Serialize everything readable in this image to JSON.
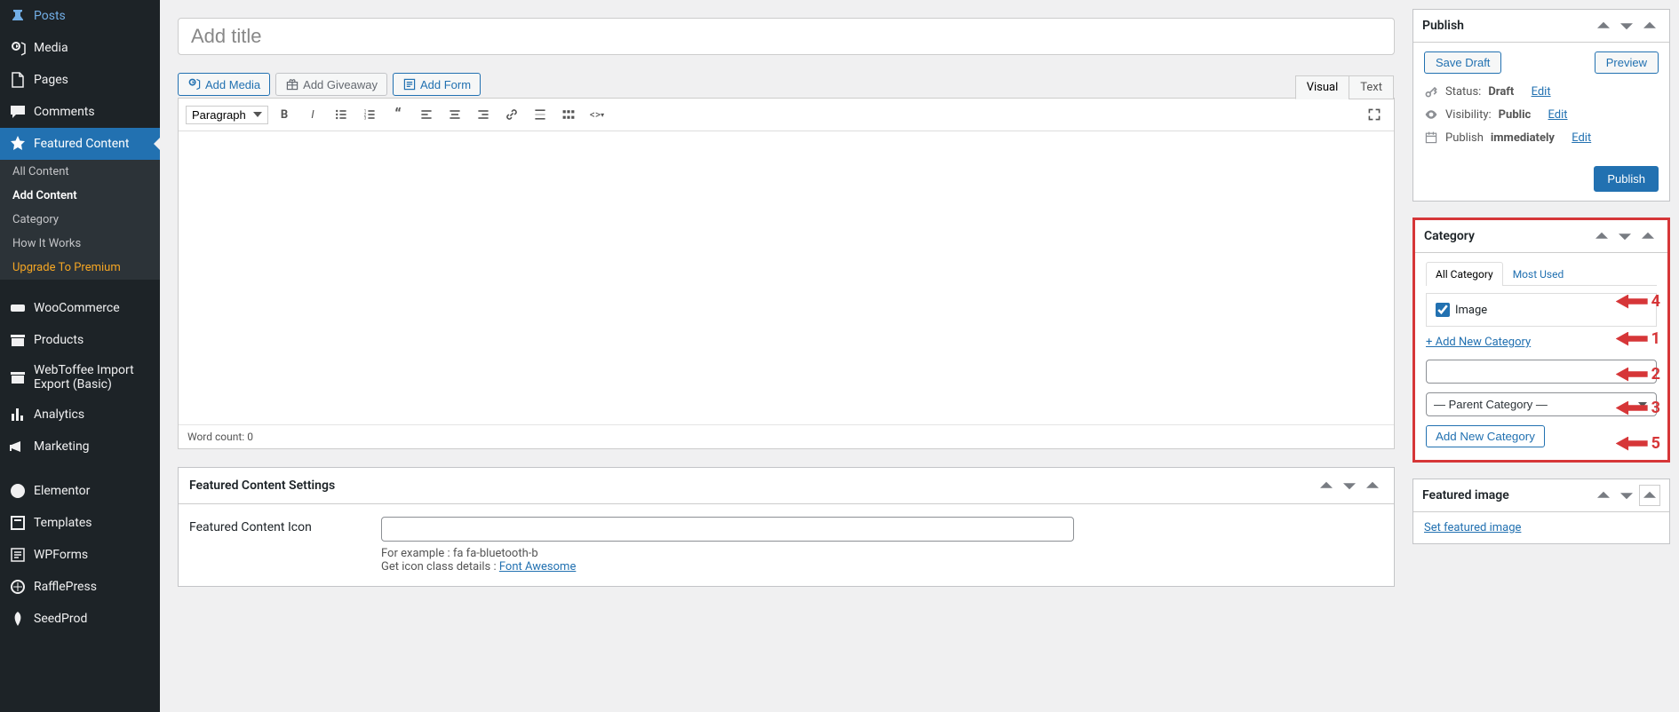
{
  "sidebar": {
    "items": [
      {
        "label": "Posts",
        "icon": "pin"
      },
      {
        "label": "Media",
        "icon": "media"
      },
      {
        "label": "Pages",
        "icon": "page"
      },
      {
        "label": "Comments",
        "icon": "comment"
      },
      {
        "label": "Featured Content",
        "icon": "star",
        "active": true
      },
      {
        "label": "WooCommerce",
        "icon": "woo"
      },
      {
        "label": "Products",
        "icon": "archive"
      },
      {
        "label": "WebToffee Import Export (Basic)",
        "icon": "archive"
      },
      {
        "label": "Analytics",
        "icon": "chart"
      },
      {
        "label": "Marketing",
        "icon": "megaphone"
      },
      {
        "label": "Elementor",
        "icon": "elementor"
      },
      {
        "label": "Templates",
        "icon": "templates"
      },
      {
        "label": "WPForms",
        "icon": "wpforms"
      },
      {
        "label": "RafflePress",
        "icon": "raffle"
      },
      {
        "label": "SeedProd",
        "icon": "seed"
      }
    ],
    "submenu": [
      {
        "label": "All Content"
      },
      {
        "label": "Add Content",
        "selected": true
      },
      {
        "label": "Category"
      },
      {
        "label": "How It Works"
      },
      {
        "label": "Upgrade To Premium",
        "premium": true
      }
    ]
  },
  "editor": {
    "title_placeholder": "Add title",
    "media_buttons": [
      {
        "label": "Add Media",
        "icon": "media"
      },
      {
        "label": "Add Giveaway",
        "icon": "gift"
      },
      {
        "label": "Add Form",
        "icon": "form"
      }
    ],
    "tabs": {
      "visual": "Visual",
      "text": "Text"
    },
    "format_dropdown": "Paragraph",
    "word_count_label": "Word count: ",
    "word_count": 0
  },
  "settings_box": {
    "title": "Featured Content Settings",
    "icon_label": "Featured Content Icon",
    "icon_help1": "For example : fa fa-bluetooth-b",
    "icon_help2": "Get icon class details : ",
    "icon_link": "Font Awesome"
  },
  "publish": {
    "title": "Publish",
    "save_draft": "Save Draft",
    "preview": "Preview",
    "status_label": "Status: ",
    "status_value": "Draft",
    "visibility_label": "Visibility: ",
    "visibility_value": "Public",
    "publish_label": "Publish ",
    "publish_value": "immediately",
    "edit": "Edit",
    "publish_btn": "Publish"
  },
  "category": {
    "title": "Category",
    "tab_all": "All Category",
    "tab_most": "Most Used",
    "item_label": "Image",
    "add_link": "+ Add New Category",
    "parent_placeholder": "— Parent Category —",
    "add_btn": "Add New Category",
    "annotations": [
      "1",
      "2",
      "3",
      "4",
      "5"
    ]
  },
  "featured_image": {
    "title": "Featured image",
    "link": "Set featured image"
  }
}
